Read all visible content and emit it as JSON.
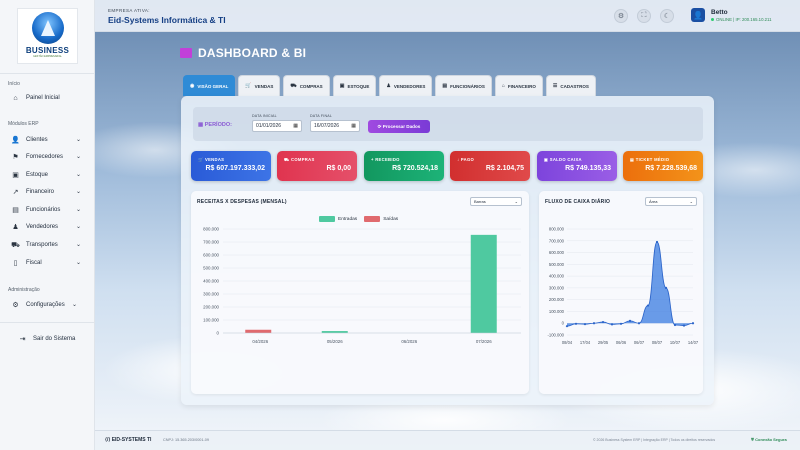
{
  "sidebar": {
    "logo_text": "BUSINESS",
    "logo_sub": "GESTÃO EMPRESARIAL",
    "section_inicio": "Início",
    "painel_inicial": "Painel Inicial",
    "section_modulos": "Módulos ERP",
    "items": [
      {
        "label": "Clientes"
      },
      {
        "label": "Fornecedores"
      },
      {
        "label": "Estoque"
      },
      {
        "label": "Financeiro"
      },
      {
        "label": "Funcionários"
      },
      {
        "label": "Vendedores"
      },
      {
        "label": "Transportes"
      },
      {
        "label": "Fiscal"
      }
    ],
    "section_admin": "Administração",
    "configuracoes": "Configurações",
    "logout": "Sair do Sistema"
  },
  "header": {
    "empresa_label": "EMPRESA ATIVA:",
    "empresa_name": "Eid-Systems Informática & TI",
    "user_name": "Betto",
    "user_status": "ONLINE | IP: 200.165.10.211"
  },
  "page": {
    "title": "DASHBOARD & BI",
    "tabs": [
      "VISÃO GERAL",
      "VENDAS",
      "COMPRAS",
      "ESTOQUE",
      "VENDEDORES",
      "FUNCIONÁRIOS",
      "FINANCEIRO",
      "CADASTROS"
    ],
    "filter": {
      "periodo_label": "PERÍODO:",
      "data_inicial_label": "DATA INICIAL",
      "data_inicial": "01/01/2026",
      "data_final_label": "DATA FINAL",
      "data_final": "16/07/2026",
      "processar": "Processar Dados"
    },
    "kpis": [
      {
        "label": "VENDAS",
        "value": "R$ 607.197.333,02",
        "color": "#2a5bd7"
      },
      {
        "label": "COMPRAS",
        "value": "R$ 0,00",
        "color": "#e0344f"
      },
      {
        "label": "RECEBIDO",
        "value": "R$ 720.524,18",
        "color": "#16a36a"
      },
      {
        "label": "PAGO",
        "value": "R$ 2.104,75",
        "color": "#d93a3a"
      },
      {
        "label": "SALDO CAIXA",
        "value": "R$ 749.135,33",
        "color": "#8a4fe0"
      },
      {
        "label": "TICKET MÉDIO",
        "value": "R$ 7.228.539,68",
        "color": "#ef7d10"
      }
    ]
  },
  "chart_left": {
    "title": "RECEITAS X DESPESAS (MENSAL)",
    "select": "Barras",
    "legend_entradas": "Entradas",
    "legend_saidas": "Saídas"
  },
  "chart_right": {
    "title": "FLUXO DE CAIXA DIÁRIO",
    "select": "Área"
  },
  "footer": {
    "brand": "EID-SYSTEMS TI",
    "cnpj": "CNPJ: 15.365.203/0001-09",
    "copyright": "© 2026 Business System ERP | Integração ERP | Todos os direitos reservados",
    "secure": "Conexão Segura"
  },
  "colors": {
    "entradas": "#4fc9a0",
    "saidas": "#e06a6e",
    "area": "#3a7be0",
    "accent": "#2f8bd6"
  },
  "chart_data": [
    {
      "type": "bar",
      "title": "RECEITAS X DESPESAS (MENSAL)",
      "categories": [
        "04/2026",
        "05/2026",
        "06/2026",
        "07/2026"
      ],
      "series": [
        {
          "name": "Entradas",
          "values": [
            0,
            15000,
            0,
            755000
          ]
        },
        {
          "name": "Saídas",
          "values": [
            25000,
            0,
            0,
            0
          ]
        }
      ],
      "ylim": [
        0,
        800000
      ],
      "yticks": [
        "0",
        "100.000",
        "200.000",
        "300.000",
        "400.000",
        "500.000",
        "600.000",
        "700.000",
        "800.000"
      ]
    },
    {
      "type": "area",
      "title": "FLUXO DE CAIXA DIÁRIO",
      "x": [
        "08/04",
        "",
        "17/04",
        "",
        "29/05",
        "",
        "06/06",
        "",
        "06/07",
        "",
        "08/07",
        "",
        "10/07",
        "",
        "14/07"
      ],
      "x_tick_labels": [
        "08/04",
        "17/04",
        "29/05",
        "06/06",
        "06/07",
        "08/07",
        "10/07",
        "14/07"
      ],
      "values": [
        -25000,
        -5000,
        -8000,
        0,
        10000,
        -10000,
        -5000,
        20000,
        0,
        150000,
        690000,
        300000,
        -15000,
        -20000,
        0
      ],
      "ylim": [
        -100000,
        800000
      ],
      "yticks": [
        "-100.000",
        "0",
        "100.000",
        "200.000",
        "300.000",
        "400.000",
        "500.000",
        "600.000",
        "700.000",
        "800.000"
      ]
    }
  ]
}
